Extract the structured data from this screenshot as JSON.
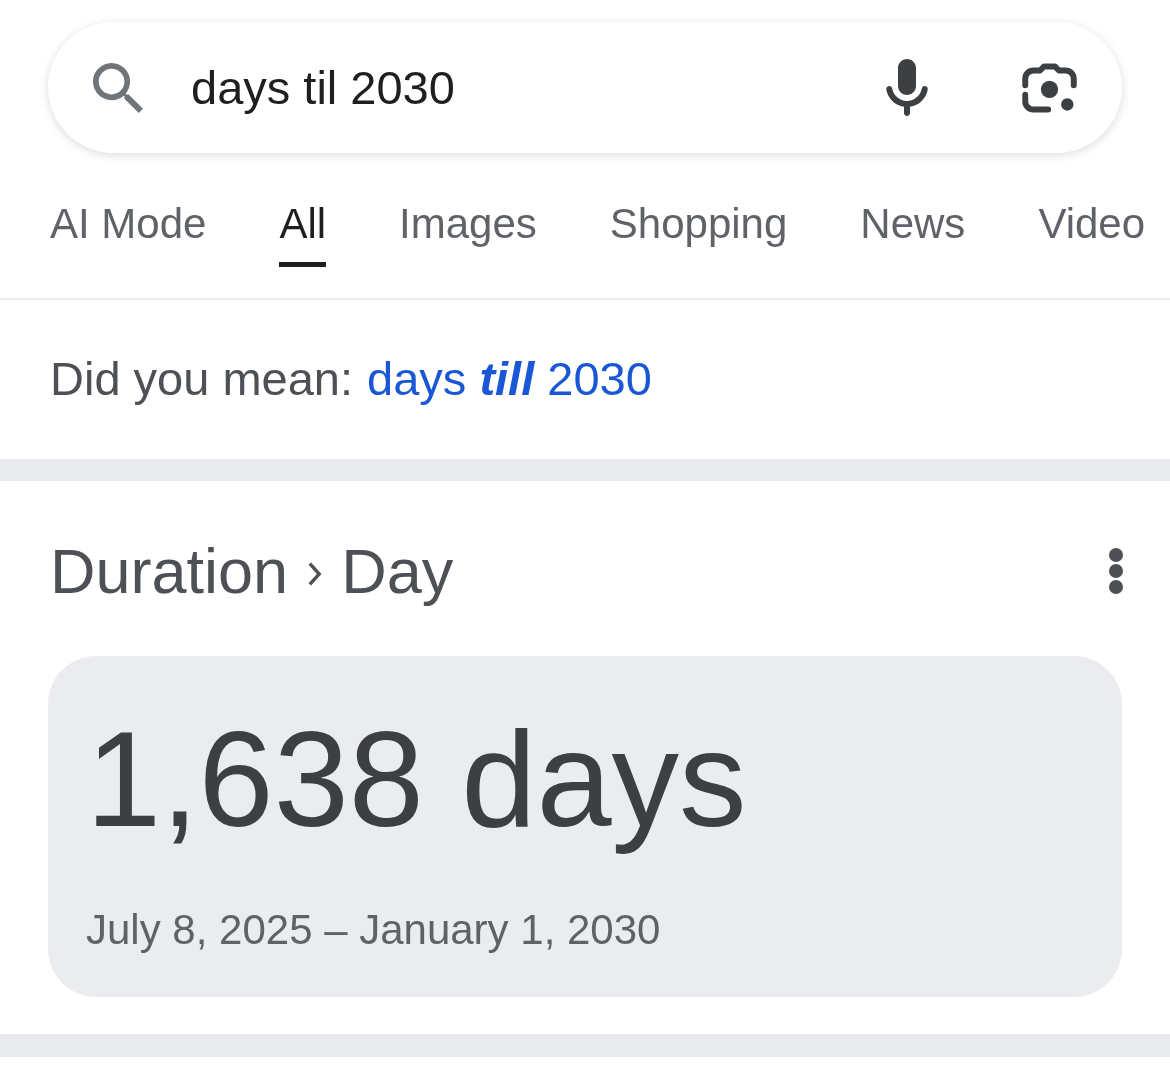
{
  "search": {
    "value": "days til 2030"
  },
  "tabs": [
    {
      "label": "AI Mode",
      "selected": false
    },
    {
      "label": "All",
      "selected": true
    },
    {
      "label": "Images",
      "selected": false
    },
    {
      "label": "Shopping",
      "selected": false
    },
    {
      "label": "News",
      "selected": false
    },
    {
      "label": "Video",
      "selected": false
    }
  ],
  "spelling_suggestion": {
    "prompt": "Did you mean:",
    "suggestion": "days **till** 2030"
  },
  "answer": {
    "breadcrumb": [
      "Duration",
      "Day"
    ],
    "result": "1,638 days",
    "date_range": "July 8, 2025 – January 1, 2030"
  }
}
